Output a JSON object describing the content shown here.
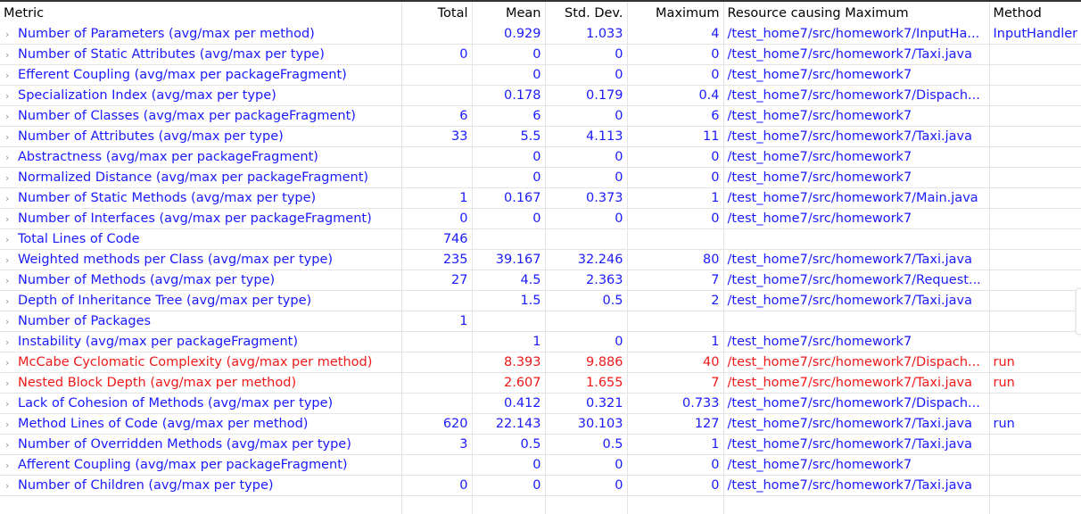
{
  "columns": [
    "Metric",
    "Total",
    "Mean",
    "Std. Dev.",
    "Maximum",
    "Resource causing Maximum",
    "Method"
  ],
  "colors": {
    "normal": "#1a1aff",
    "violation": "#f01818"
  },
  "rows": [
    {
      "metric": "Number of Parameters (avg/max per method)",
      "total": "",
      "mean": "0.929",
      "std": "1.033",
      "max": "4",
      "resource": "/test_home7/src/homework7/InputHa...",
      "method": "InputHandler",
      "red": false
    },
    {
      "metric": "Number of Static Attributes (avg/max per type)",
      "total": "0",
      "mean": "0",
      "std": "0",
      "max": "0",
      "resource": "/test_home7/src/homework7/Taxi.java",
      "method": "",
      "red": false
    },
    {
      "metric": "Efferent Coupling (avg/max per packageFragment)",
      "total": "",
      "mean": "0",
      "std": "0",
      "max": "0",
      "resource": "/test_home7/src/homework7",
      "method": "",
      "red": false
    },
    {
      "metric": "Specialization Index (avg/max per type)",
      "total": "",
      "mean": "0.178",
      "std": "0.179",
      "max": "0.4",
      "resource": "/test_home7/src/homework7/Dispach...",
      "method": "",
      "red": false
    },
    {
      "metric": "Number of Classes (avg/max per packageFragment)",
      "total": "6",
      "mean": "6",
      "std": "0",
      "max": "6",
      "resource": "/test_home7/src/homework7",
      "method": "",
      "red": false
    },
    {
      "metric": "Number of Attributes (avg/max per type)",
      "total": "33",
      "mean": "5.5",
      "std": "4.113",
      "max": "11",
      "resource": "/test_home7/src/homework7/Taxi.java",
      "method": "",
      "red": false
    },
    {
      "metric": "Abstractness (avg/max per packageFragment)",
      "total": "",
      "mean": "0",
      "std": "0",
      "max": "0",
      "resource": "/test_home7/src/homework7",
      "method": "",
      "red": false
    },
    {
      "metric": "Normalized Distance (avg/max per packageFragment)",
      "total": "",
      "mean": "0",
      "std": "0",
      "max": "0",
      "resource": "/test_home7/src/homework7",
      "method": "",
      "red": false
    },
    {
      "metric": "Number of Static Methods (avg/max per type)",
      "total": "1",
      "mean": "0.167",
      "std": "0.373",
      "max": "1",
      "resource": "/test_home7/src/homework7/Main.java",
      "method": "",
      "red": false
    },
    {
      "metric": "Number of Interfaces (avg/max per packageFragment)",
      "total": "0",
      "mean": "0",
      "std": "0",
      "max": "0",
      "resource": "/test_home7/src/homework7",
      "method": "",
      "red": false
    },
    {
      "metric": "Total Lines of Code",
      "total": "746",
      "mean": "",
      "std": "",
      "max": "",
      "resource": "",
      "method": "",
      "red": false
    },
    {
      "metric": "Weighted methods per Class (avg/max per type)",
      "total": "235",
      "mean": "39.167",
      "std": "32.246",
      "max": "80",
      "resource": "/test_home7/src/homework7/Taxi.java",
      "method": "",
      "red": false
    },
    {
      "metric": "Number of Methods (avg/max per type)",
      "total": "27",
      "mean": "4.5",
      "std": "2.363",
      "max": "7",
      "resource": "/test_home7/src/homework7/Request...",
      "method": "",
      "red": false
    },
    {
      "metric": "Depth of Inheritance Tree (avg/max per type)",
      "total": "",
      "mean": "1.5",
      "std": "0.5",
      "max": "2",
      "resource": "/test_home7/src/homework7/Taxi.java",
      "method": "",
      "red": false
    },
    {
      "metric": "Number of Packages",
      "total": "1",
      "mean": "",
      "std": "",
      "max": "",
      "resource": "",
      "method": "",
      "red": false
    },
    {
      "metric": "Instability (avg/max per packageFragment)",
      "total": "",
      "mean": "1",
      "std": "0",
      "max": "1",
      "resource": "/test_home7/src/homework7",
      "method": "",
      "red": false
    },
    {
      "metric": "McCabe Cyclomatic Complexity (avg/max per method)",
      "total": "",
      "mean": "8.393",
      "std": "9.886",
      "max": "40",
      "resource": "/test_home7/src/homework7/Dispach...",
      "method": "run",
      "red": true
    },
    {
      "metric": "Nested Block Depth (avg/max per method)",
      "total": "",
      "mean": "2.607",
      "std": "1.655",
      "max": "7",
      "resource": "/test_home7/src/homework7/Taxi.java",
      "method": "run",
      "red": true
    },
    {
      "metric": "Lack of Cohesion of Methods (avg/max per type)",
      "total": "",
      "mean": "0.412",
      "std": "0.321",
      "max": "0.733",
      "resource": "/test_home7/src/homework7/Dispach...",
      "method": "",
      "red": false
    },
    {
      "metric": "Method Lines of Code (avg/max per method)",
      "total": "620",
      "mean": "22.143",
      "std": "30.103",
      "max": "127",
      "resource": "/test_home7/src/homework7/Taxi.java",
      "method": "run",
      "red": false
    },
    {
      "metric": "Number of Overridden Methods (avg/max per type)",
      "total": "3",
      "mean": "0.5",
      "std": "0.5",
      "max": "1",
      "resource": "/test_home7/src/homework7/Taxi.java",
      "method": "",
      "red": false
    },
    {
      "metric": "Afferent Coupling (avg/max per packageFragment)",
      "total": "",
      "mean": "0",
      "std": "0",
      "max": "0",
      "resource": "/test_home7/src/homework7",
      "method": "",
      "red": false
    },
    {
      "metric": "Number of Children (avg/max per type)",
      "total": "0",
      "mean": "0",
      "std": "0",
      "max": "0",
      "resource": "/test_home7/src/homework7/Taxi.java",
      "method": "",
      "red": false
    }
  ]
}
